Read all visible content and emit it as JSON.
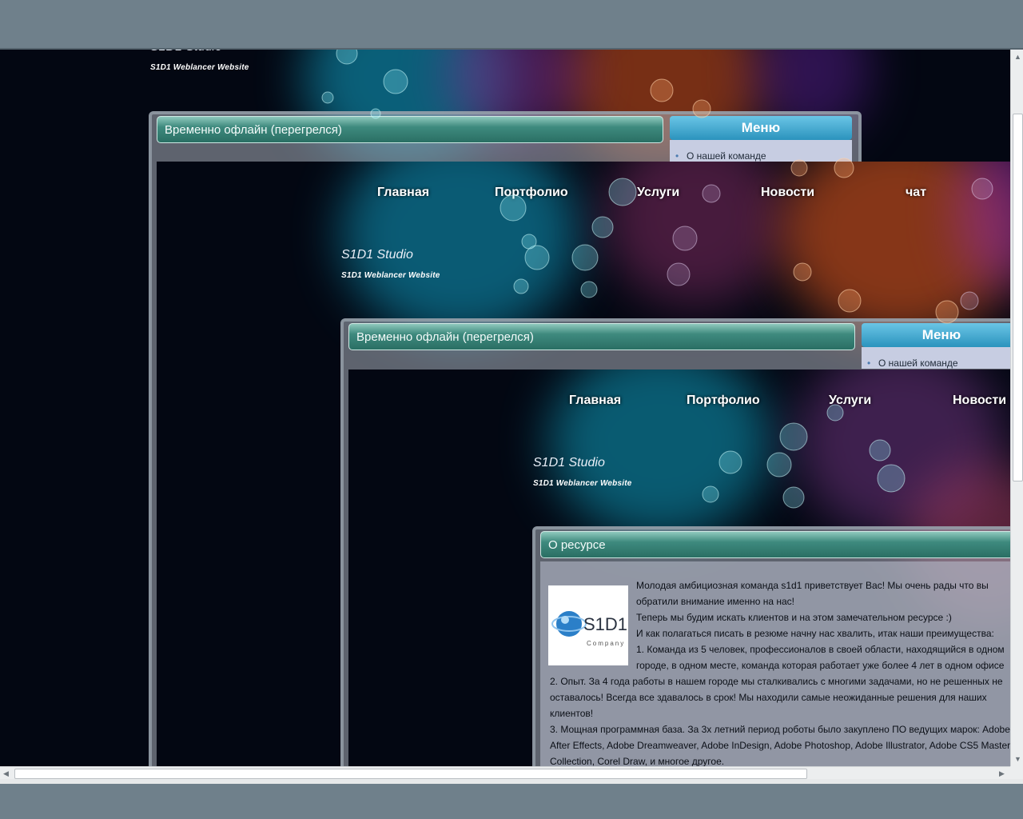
{
  "site": {
    "logo_title": "S1D1 Studio",
    "logo_subtitle": "S1D1 Weblancer Website"
  },
  "nav": [
    "Главная",
    "Портфолио",
    "Услуги",
    "Новости",
    "чат"
  ],
  "status_bar": {
    "title": "Временно офлайн (перегрелся)"
  },
  "menu": {
    "header": "Меню",
    "items": [
      "О нашей команде"
    ]
  },
  "about": {
    "title": "О ресурсе",
    "logo_text": "S1D1",
    "logo_sub": "Company",
    "paragraphs": [
      "Молодая амбициозная команда s1d1 приветствует Вас! Мы очень рады что вы обратили внимание именно на нас!",
      "Теперь мы будим искать клиентов и на этом замечательном ресурсе :)",
      "И как полагаться писать в резюме начну нас хвалить, итак наши преимущества:",
      "1. Команда из 5 человек, профессионалов в своей области, находящийся в одном городе, в одном месте, команда которая работает уже более 4 лет в одном офисе",
      "2. Опыт. За 4 года работы в нашем городе мы сталкивались с многими задачами, но не решенных не оставалось! Всегда все здавалось в срок! Мы находили самые неожиданные решения для наших клиентов!",
      "3. Мощная программная база. За 3х летний период роботы было закуплено ПО ведущих марок: Adobe After Effects, Adobe Dreamweaver, Adobe InDesign, Adobe Photoshop, Adobe Illustrator, Adobe CS5 Master Collection, Corel Draw, и многое другое."
    ]
  },
  "colors": {
    "teal_bar": "#2a6f64",
    "menu_header": "#2b93bd",
    "page_bg": "#030712",
    "chrome": "#6f808b"
  }
}
